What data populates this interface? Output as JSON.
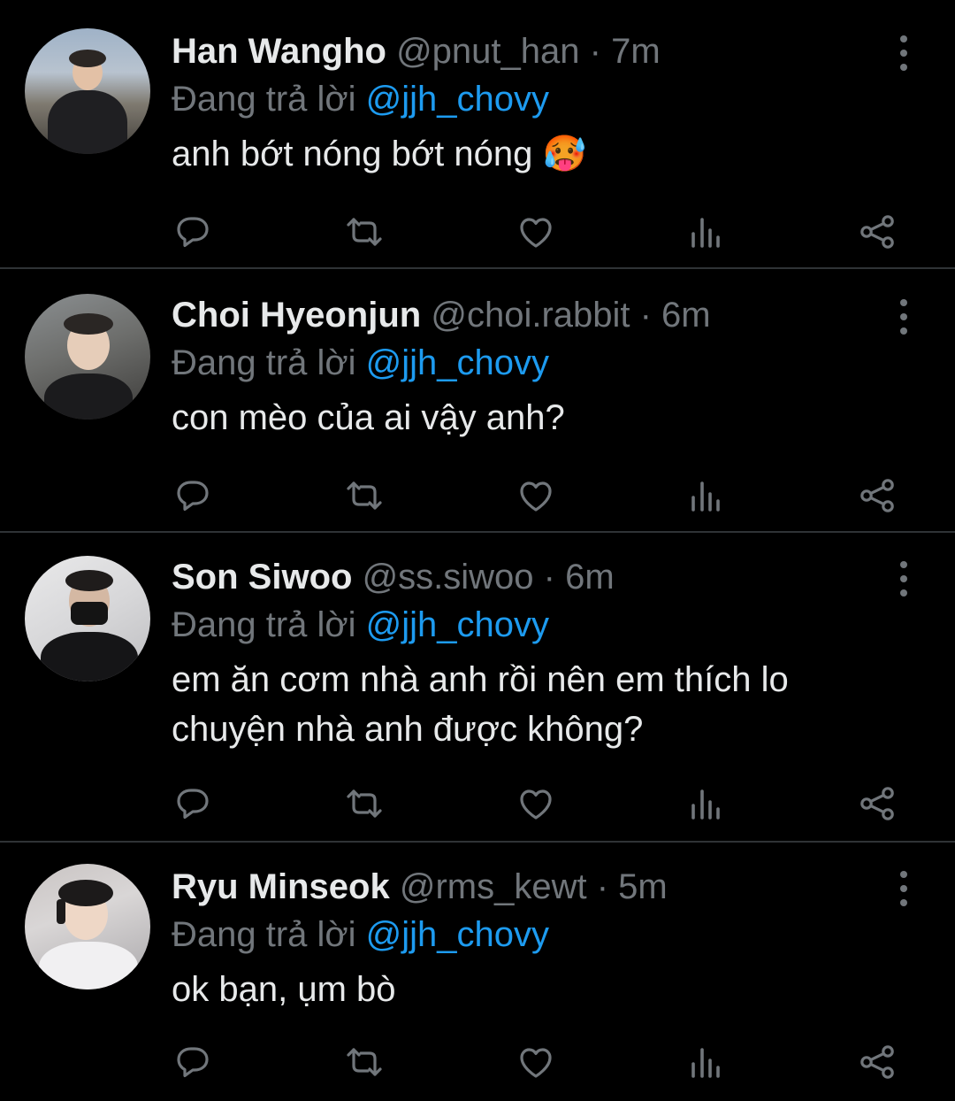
{
  "tweets": [
    {
      "name": "Han Wangho",
      "handle": "@pnut_han",
      "time": "· 7m",
      "replying_prefix": "Đang trả lời",
      "replying_to": "@jjh_chovy",
      "text": "anh bớt nóng bớt nóng 🥵"
    },
    {
      "name": "Choi Hyeonjun",
      "handle": "@choi.rabbit",
      "time": "· 6m",
      "replying_prefix": "Đang trả lời",
      "replying_to": "@jjh_chovy",
      "text": "con mèo của ai vậy anh?"
    },
    {
      "name": "Son Siwoo",
      "handle": "@ss.siwoo",
      "time": "· 6m",
      "replying_prefix": "Đang trả lời",
      "replying_to": "@jjh_chovy",
      "text": "em ăn cơm nhà anh rồi nên em thích lo chuyện nhà anh được không?"
    },
    {
      "name": "Ryu Minseok",
      "handle": "@rms_kewt",
      "time": "· 5m",
      "replying_prefix": "Đang trả lời",
      "replying_to": "@jjh_chovy",
      "text": "ok bạn, ụm bò"
    }
  ],
  "icons": [
    "reply-icon",
    "retweet-icon",
    "like-icon",
    "views-icon",
    "share-icon",
    "more-options-icon"
  ],
  "colors": {
    "background": "#000000",
    "text": "#e7e9ea",
    "secondary": "#71767b",
    "accent": "#1d9bf0",
    "divider": "#2f3336"
  }
}
